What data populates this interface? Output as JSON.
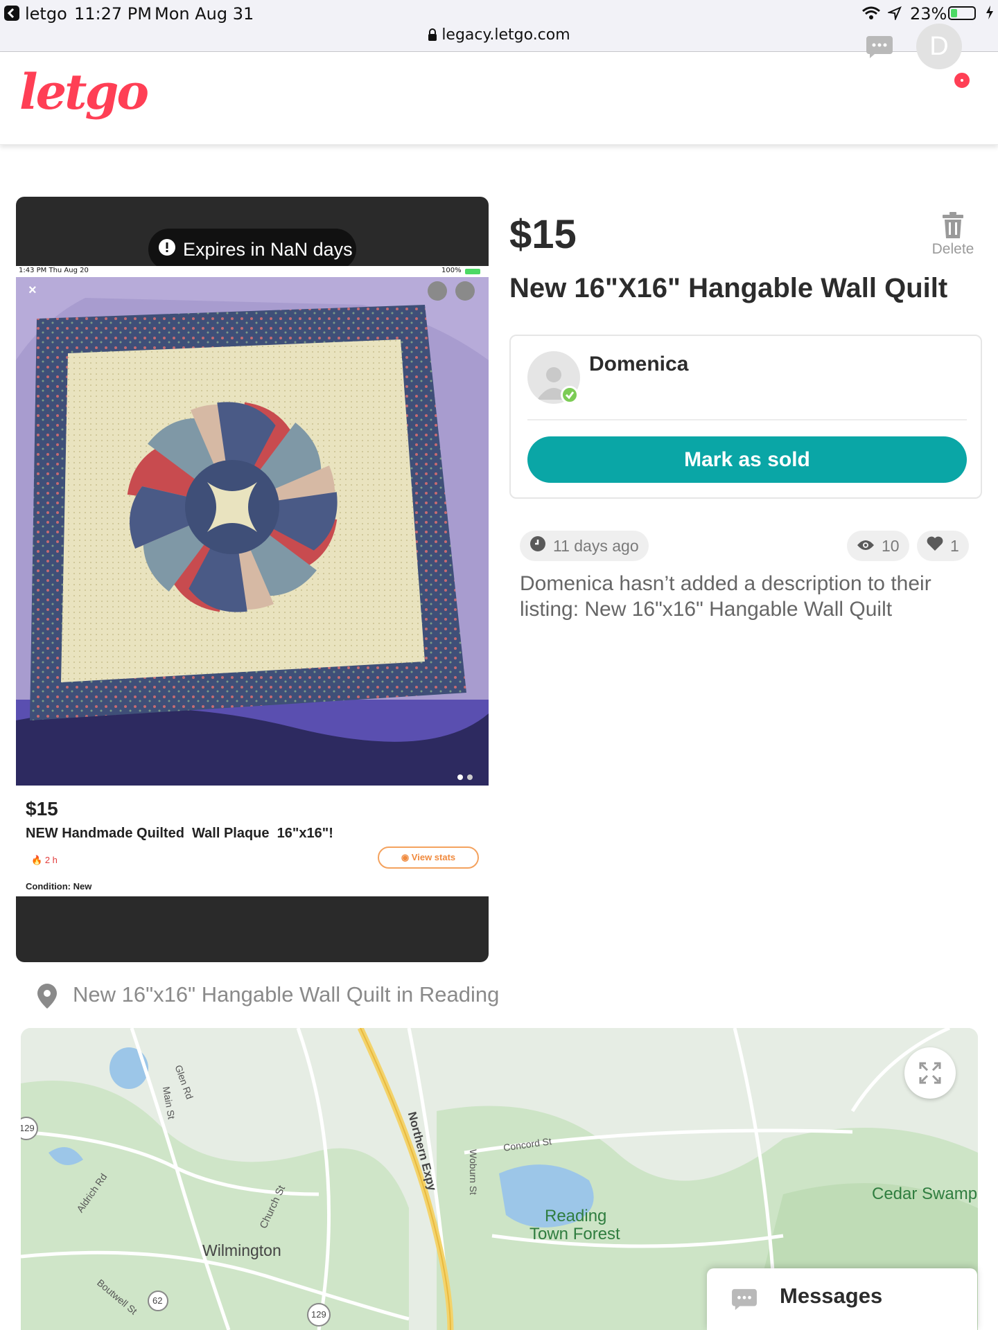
{
  "status_bar": {
    "back_app": "letgo",
    "time": "11:27 PM",
    "date": "Mon Aug 31",
    "battery": "23%",
    "url": "legacy.letgo.com"
  },
  "header": {
    "logo": "letgo",
    "avatar_initial": "D"
  },
  "photo": {
    "expires_text": "Expires in NaN days",
    "shot_status_time": "1:43 PM   Thu Aug 20",
    "shot_status_battery": "100%",
    "shot_price": "$15",
    "shot_title": "NEW Handmade Quilted  Wall Plaque  16\"x16\"!",
    "shot_age": "2 h",
    "shot_stats_label": "View stats",
    "shot_condition": "Condition: New"
  },
  "listing": {
    "price": "$15",
    "delete_label": "Delete",
    "title": "New 16\"X16\" Hangable Wall Quilt",
    "seller_name": "Domenica",
    "mark_sold_label": "Mark as sold",
    "age": "11 days ago",
    "views": "10",
    "likes": "1",
    "description": "Domenica hasn’t added a description to their listing: New 16\"x16\" Hangable Wall Quilt",
    "location_text": "New 16\"x16\" Hangable Wall Quilt in Reading"
  },
  "map": {
    "labels": {
      "glen_rd": "Glen Rd",
      "main_st": "Main St",
      "aldrich_rd": "Aldrich Rd",
      "church_st": "Church St",
      "wilmington": "Wilmington",
      "boutwell_st": "Boutwell St",
      "northern_expy": "Northern Expy",
      "woburn_st": "Woburn St",
      "concord_st": "Concord St",
      "reading_forest_1": "Reading",
      "reading_forest_2": "Town Forest",
      "cedar_swamp": "Cedar Swamp",
      "route_129_a": "129",
      "route_129_b": "129",
      "route_62": "62"
    }
  },
  "messages": {
    "label": "Messages"
  },
  "colors": {
    "brand": "#ff3f55",
    "teal": "#0aa6a6",
    "badge_green": "#7ccc55"
  }
}
